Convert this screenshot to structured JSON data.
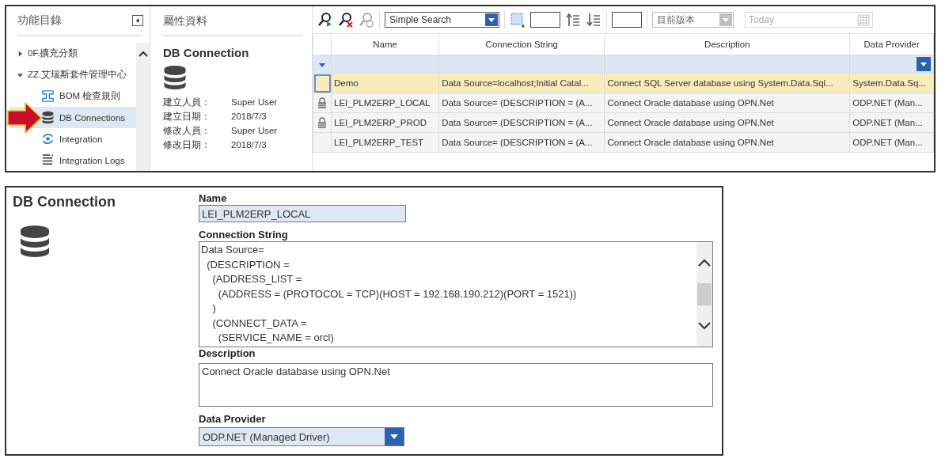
{
  "sidebar": {
    "title": "功能目錄",
    "items": [
      {
        "label": "0F.擴充分類",
        "expanded": false,
        "selected": false
      },
      {
        "label": "ZZ.艾瑞斯套件管理中心",
        "expanded": true,
        "selected": false,
        "children": [
          {
            "label": "BOM 檢查規則",
            "selected": false
          },
          {
            "label": "DB Connections",
            "selected": true
          },
          {
            "label": "Integration",
            "selected": false
          },
          {
            "label": "Integration Logs",
            "selected": false
          }
        ]
      }
    ]
  },
  "properties": {
    "title": "屬性資料",
    "heading": "DB Connection",
    "fields": [
      {
        "label": "建立人員：",
        "value": "Super User"
      },
      {
        "label": "建立日期：",
        "value": "2018/7/3"
      },
      {
        "label": "修改人員：",
        "value": "Super User"
      },
      {
        "label": "修改日期：",
        "value": "2018/7/3"
      }
    ]
  },
  "toolbar": {
    "search_mode": {
      "value": "Simple Search"
    },
    "version": {
      "value": "目前版本",
      "disabled": true
    },
    "date": {
      "placeholder": "Today",
      "disabled": true
    }
  },
  "grid": {
    "columns": [
      "Name",
      "Connection String",
      "Description",
      "Data Provider"
    ],
    "rows": [
      {
        "locked": false,
        "selected": true,
        "cells": [
          "Demo",
          "Data Source=localhost;Initial Catal...",
          "Connect SQL Server database using System.Data.Sql...",
          "System.Data.Sq..."
        ]
      },
      {
        "locked": true,
        "selected": false,
        "cells": [
          "LEI_PLM2ERP_LOCAL",
          "Data Source= (DESCRIPTION = (A...",
          "Connect Oracle database using OPN.Net",
          "ODP.NET (Man..."
        ]
      },
      {
        "locked": true,
        "selected": false,
        "cells": [
          "LEI_PLM2ERP_PROD",
          "Data Source= (DESCRIPTION = (A...",
          "Connect Oracle database using OPN.Net",
          "ODP.NET (Man..."
        ]
      },
      {
        "locked": false,
        "selected": false,
        "cells": [
          "LEI_PLM2ERP_TEST",
          "Data Source= (DESCRIPTION = (A...",
          "Connect Oracle database using OPN.Net",
          "ODP.NET (Man..."
        ]
      }
    ]
  },
  "form": {
    "title": "DB Connection",
    "name": {
      "label": "Name",
      "value": "LEI_PLM2ERP_LOCAL"
    },
    "connection_string": {
      "label": "Connection String",
      "lines": [
        "Data Source=",
        "  (DESCRIPTION =",
        "    (ADDRESS_LIST =",
        "      (ADDRESS = (PROTOCOL = TCP)(HOST = 192.168.190.212)(PORT = 1521))",
        "    )",
        "    (CONNECT_DATA =",
        "      (SERVICE_NAME = orcl)"
      ]
    },
    "description": {
      "label": "Description",
      "value": "Connect Oracle database using OPN.Net"
    },
    "data_provider": {
      "label": "Data Provider",
      "value": "ODP.NET (Managed Driver)"
    }
  }
}
